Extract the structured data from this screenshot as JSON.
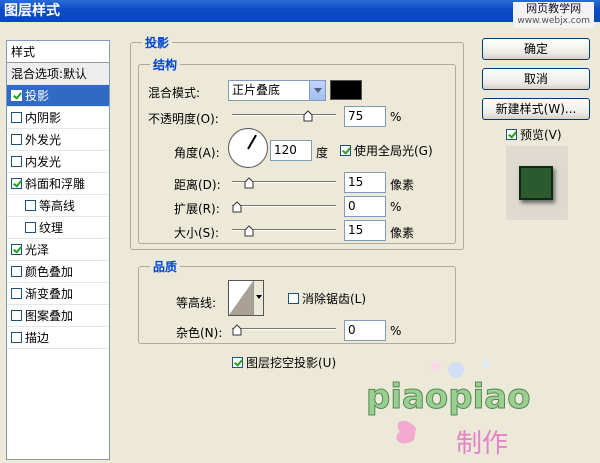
{
  "window": {
    "title": "图层样式"
  },
  "watermark": {
    "site": "网页教学网",
    "url": "www.webjx.com"
  },
  "sidebar": {
    "header": "样式",
    "items": [
      {
        "label": "混合选项:默认",
        "type": "plain"
      },
      {
        "label": "投影",
        "checked": true,
        "selected": true
      },
      {
        "label": "内阴影",
        "checked": false
      },
      {
        "label": "外发光",
        "checked": false
      },
      {
        "label": "内发光",
        "checked": false
      },
      {
        "label": "斜面和浮雕",
        "checked": true
      },
      {
        "label": "等高线",
        "checked": false,
        "indent": true
      },
      {
        "label": "纹理",
        "checked": false,
        "indent": true
      },
      {
        "label": "光泽",
        "checked": true
      },
      {
        "label": "颜色叠加",
        "checked": false
      },
      {
        "label": "渐变叠加",
        "checked": false
      },
      {
        "label": "图案叠加",
        "checked": false
      },
      {
        "label": "描边",
        "checked": false
      }
    ]
  },
  "drop_shadow": {
    "title": "投影",
    "structure": {
      "title": "结构",
      "blend_mode_label": "混合模式:",
      "blend_mode_value": "正片叠底",
      "shadow_color": "#000000",
      "opacity_label": "不透明度(O):",
      "opacity_value": "75",
      "opacity_unit": "%",
      "angle_label": "角度(A):",
      "angle_value": "120",
      "angle_unit": "度",
      "global_light_label": "使用全局光(G)",
      "global_light_checked": true,
      "distance_label": "距离(D):",
      "distance_value": "15",
      "distance_unit": "像素",
      "spread_label": "扩展(R):",
      "spread_value": "0",
      "spread_unit": "%",
      "size_label": "大小(S):",
      "size_value": "15",
      "size_unit": "像素"
    },
    "quality": {
      "title": "品质",
      "contour_label": "等高线:",
      "antialias_label": "消除锯齿(L)",
      "antialias_checked": false,
      "noise_label": "杂色(N):",
      "noise_value": "0",
      "noise_unit": "%"
    },
    "layer_knockout_label": "图层挖空投影(U)",
    "layer_knockout_checked": true
  },
  "buttons": {
    "ok": "确定",
    "cancel": "取消",
    "new_style": "新建样式(W)...",
    "preview_label": "预览(V)",
    "preview_checked": true
  },
  "signature": {
    "name": "piaopiao",
    "made": "制作"
  }
}
